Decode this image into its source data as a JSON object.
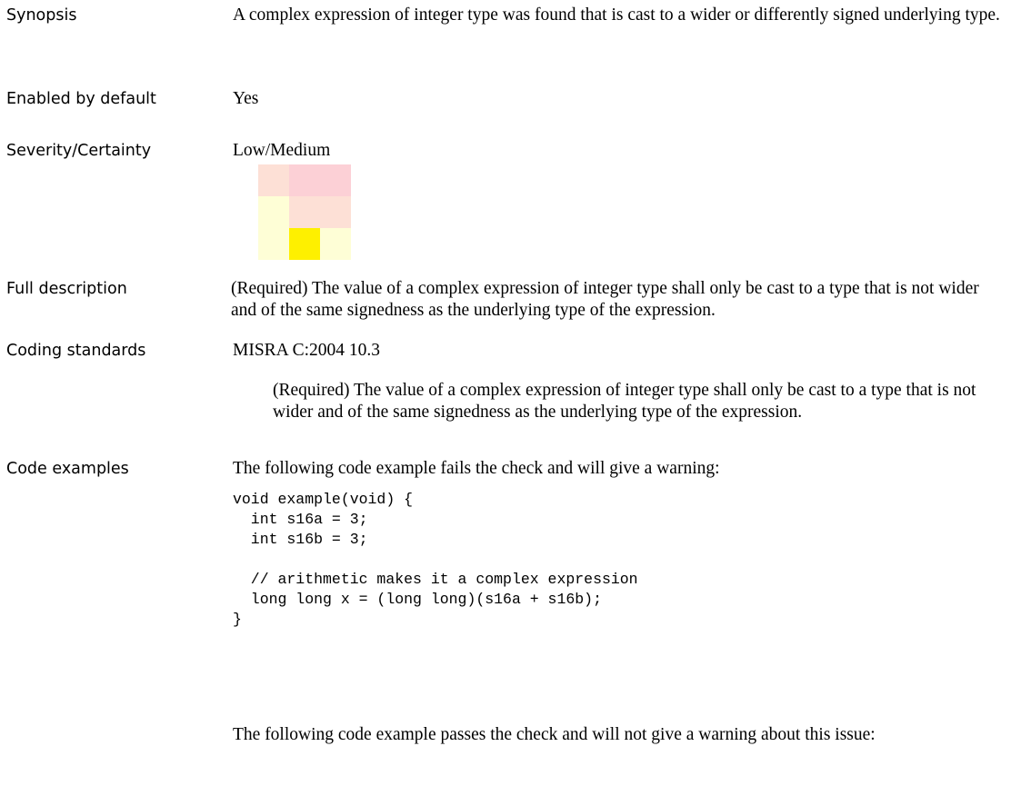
{
  "labels": {
    "synopsis": "Synopsis",
    "enabled": "Enabled by default",
    "severity": "Severity/Certainty",
    "full_description": "Full description",
    "coding_standards": "Coding standards",
    "code_examples": "Code examples"
  },
  "synopsis_text": "A complex expression of integer type was found that is cast to a wider or differently signed underlying type.",
  "enabled_text": "Yes",
  "severity_text": "Low/Medium",
  "severity_matrix": {
    "colors": [
      [
        "#fde0d6",
        "#fcd0d6",
        "#fcd0d6"
      ],
      [
        "#fefed6",
        "#fde0d6",
        "#fde0d6"
      ],
      [
        "#fefed6",
        "#fef000",
        "#fefed6"
      ]
    ]
  },
  "full_description_text": "(Required) The value of a complex expression of integer type shall only be cast to a type that is not wider and of the same signedness as the underlying type of the expression.",
  "coding_standard_name": "MISRA C:2004 10.3",
  "coding_standard_text": "(Required) The value of a complex expression of integer type shall only be cast to a type that is not wider and of the same signedness as the underlying type of the expression.",
  "code_example_fail_intro": "The following code example fails the check and will give a warning:",
  "code_example_fail": "void example(void) {\n  int s16a = 3;\n  int s16b = 3;\n\n  // arithmetic makes it a complex expression\n  long long x = (long long)(s16a + s16b);\n}",
  "code_example_pass_intro": "The following code example passes the check and will not give a warning about this issue:"
}
